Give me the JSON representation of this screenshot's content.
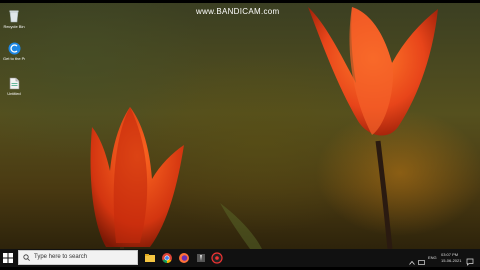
{
  "watermark": {
    "text": "www.BANDICAM.com"
  },
  "desktop": {
    "icons": [
      {
        "label": "Recycle Bin",
        "icon": "recycle-bin-icon"
      },
      {
        "label": "Get to the Programmes list",
        "icon": "ccleaner-icon"
      },
      {
        "label": "Untitled",
        "icon": "document-icon"
      }
    ]
  },
  "taskbar": {
    "search_placeholder": "Type here to search",
    "apps": [
      "file-explorer-icon",
      "chrome-icon",
      "firefox-icon",
      "app-icon",
      "bandicam-icon"
    ],
    "tray": {
      "language": "ENG",
      "time": "03:07 PM",
      "date": "15-06-2021"
    }
  },
  "colors": {
    "taskbar": "#111111",
    "tulip": "#e8451a",
    "search_box": "#f2f2f2"
  }
}
